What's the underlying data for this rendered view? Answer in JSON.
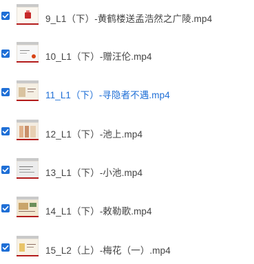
{
  "colors": {
    "checkbox": "#1f6fd6",
    "text": "#444444",
    "active_text": "#1f6fd6",
    "thumb_accent": "#b31b1b"
  },
  "files": [
    {
      "name": "9_L1（下）-黄鹤楼送孟浩然之广陵.mp4",
      "checked": true,
      "active": false,
      "icon": "video-thumbnail"
    },
    {
      "name": "10_L1（下）-赠汪伦.mp4",
      "checked": true,
      "active": false,
      "icon": "video-thumbnail"
    },
    {
      "name": "11_L1（下）-寻隐者不遇.mp4",
      "checked": true,
      "active": true,
      "icon": "video-thumbnail"
    },
    {
      "name": "12_L1（下）-池上.mp4",
      "checked": true,
      "active": false,
      "icon": "video-thumbnail"
    },
    {
      "name": "13_L1（下）-小池.mp4",
      "checked": true,
      "active": false,
      "icon": "video-thumbnail"
    },
    {
      "name": "14_L1（下）-敕勒歌.mp4",
      "checked": true,
      "active": false,
      "icon": "video-thumbnail"
    },
    {
      "name": "15_L2（上）-梅花（一）.mp4",
      "checked": true,
      "active": false,
      "icon": "video-thumbnail"
    }
  ]
}
